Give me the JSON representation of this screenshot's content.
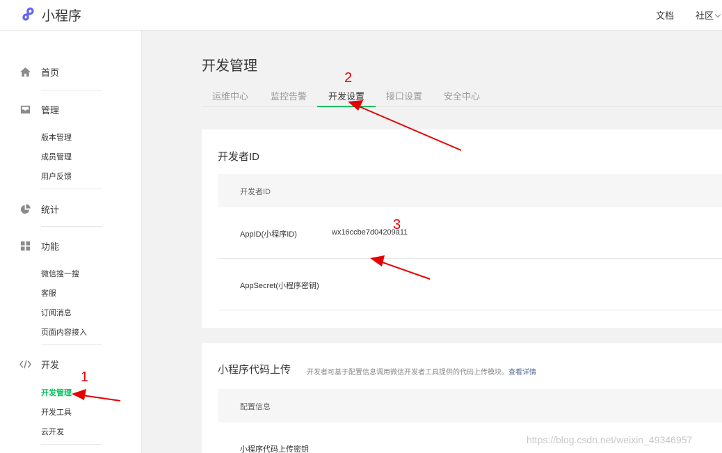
{
  "brand": {
    "name": "小程序"
  },
  "topnav": {
    "docs": "文档",
    "community": "社区"
  },
  "sidebar": {
    "home": "首页",
    "manage": {
      "label": "管理",
      "items": [
        "版本管理",
        "成员管理",
        "用户反馈"
      ]
    },
    "stats": "统计",
    "features": {
      "label": "功能",
      "items": [
        "微信搜一搜",
        "客服",
        "订阅消息",
        "页面内容接入"
      ]
    },
    "dev": {
      "label": "开发",
      "items": [
        "开发管理",
        "开发工具",
        "云开发"
      ]
    }
  },
  "page": {
    "title": "开发管理",
    "tabs": [
      "运维中心",
      "监控告警",
      "开发设置",
      "接口设置",
      "安全中心"
    ]
  },
  "dev_id_card": {
    "title": "开发者ID",
    "header": "开发者ID",
    "appid_label": "AppID(小程序ID)",
    "appid_value": "wx16ccbe7d04209a11",
    "secret_label": "AppSecret(小程序密钥)"
  },
  "upload_card": {
    "title": "小程序代码上传",
    "desc": "开发者可基于配置信息调用微信开发者工具提供的代码上传模块。",
    "link": "查看详情",
    "header": "配置信息",
    "row1": "小程序代码上传密钥"
  },
  "annotations": {
    "n1": "1",
    "n2": "2",
    "n3": "3"
  },
  "watermark": "https://blog.csdn.net/weixin_49346957",
  "colors": {
    "accent": "#07c160",
    "annotation": "#e60000",
    "logo": "#6467f0"
  }
}
